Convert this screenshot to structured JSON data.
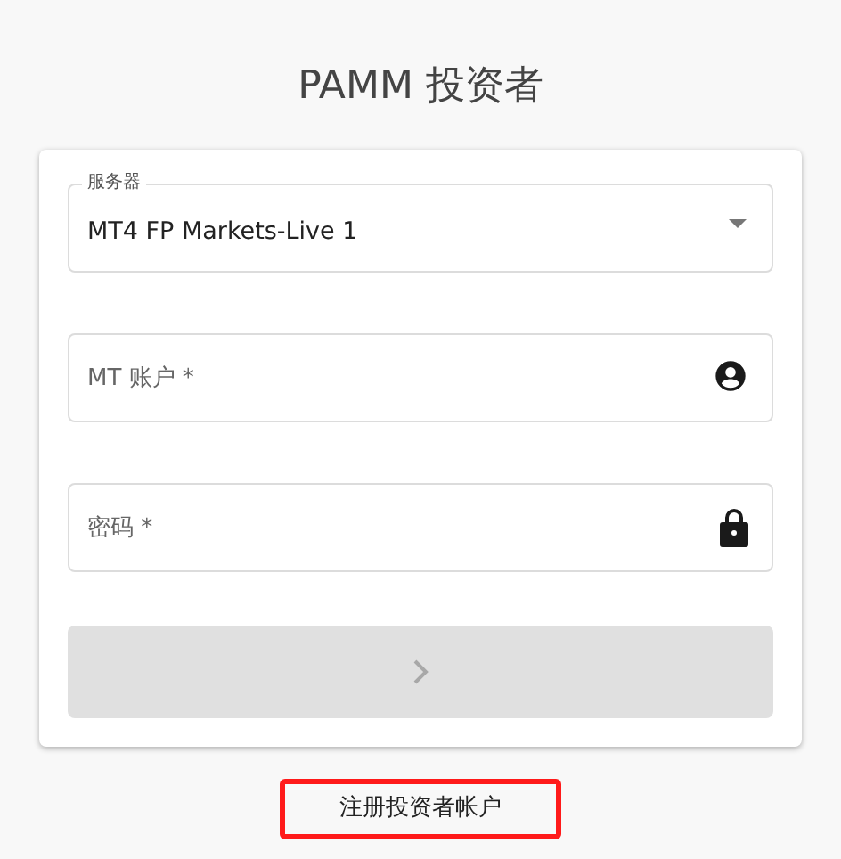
{
  "title": "PAMM 投资者",
  "server": {
    "label": "服务器",
    "value": "MT4 FP Markets-Live 1"
  },
  "fields": [
    {
      "kind": "account",
      "placeholder": "MT 账户 *"
    },
    {
      "kind": "password",
      "placeholder": "密码 *"
    }
  ],
  "submit": {
    "disabled": true
  },
  "register_link": {
    "text": "注册投资者帐户",
    "highlighted": true
  }
}
